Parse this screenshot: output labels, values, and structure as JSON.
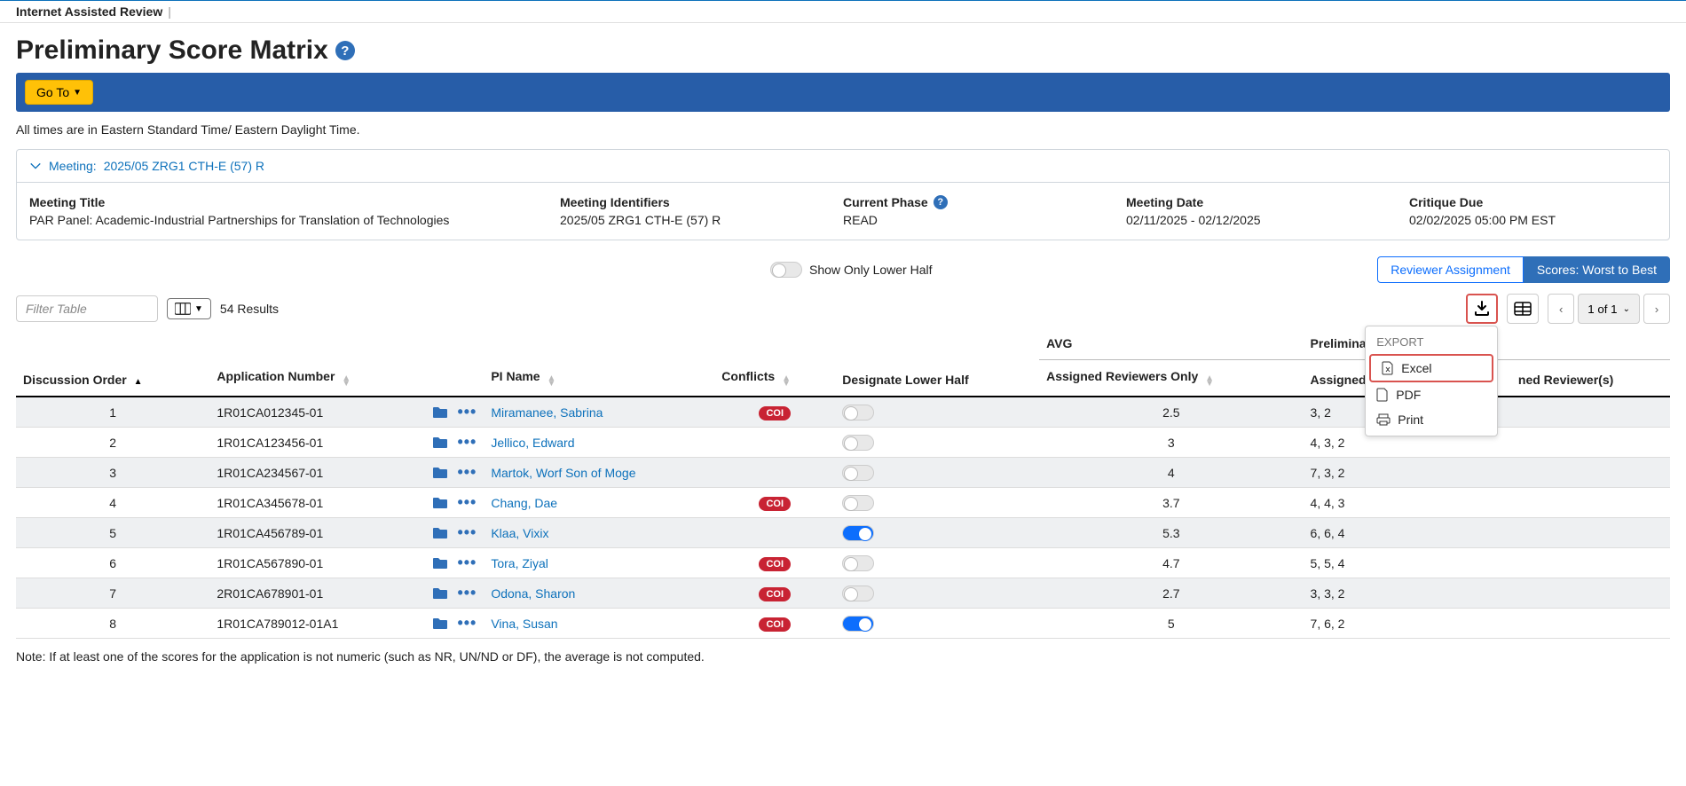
{
  "app_name": "Internet Assisted Review",
  "page_title": "Preliminary Score Matrix",
  "goto_label": "Go To",
  "timezone_note": "All times are in Eastern Standard Time/ Eastern Daylight Time.",
  "meeting": {
    "collapse_label": "Meeting:",
    "collapse_value": "2025/05 ZRG1 CTH-E (57) R",
    "title_label": "Meeting Title",
    "title_value": "PAR Panel: Academic-Industrial Partnerships for Translation of Technologies",
    "identifiers_label": "Meeting Identifiers",
    "identifiers_value": "2025/05 ZRG1 CTH-E (57) R",
    "phase_label": "Current Phase",
    "phase_value": "READ",
    "date_label": "Meeting Date",
    "date_value": "02/11/2025 - 02/12/2025",
    "critique_label": "Critique Due",
    "critique_value": "02/02/2025 05:00 PM EST"
  },
  "controls": {
    "lower_half_label": "Show Only Lower Half",
    "reviewer_assignment": "Reviewer Assignment",
    "scores_toggle": "Scores: Worst to Best",
    "filter_placeholder": "Filter Table",
    "results_count": "54 Results",
    "pager_text": "1 of 1"
  },
  "export_menu": {
    "title": "EXPORT",
    "excel": "Excel",
    "pdf": "PDF",
    "print": "Print"
  },
  "columns": {
    "discussion_order": "Discussion Order",
    "app_number": "Application Number",
    "pi_name": "PI Name",
    "conflicts": "Conflicts",
    "designate_lower": "Designate Lower Half",
    "avg_top": "AVG",
    "avg_sub": "Assigned Reviewers Only",
    "prelim_top": "Preliminary Overall/",
    "assigned_reviewers": "Assigned Reviewer(s)",
    "ned_reviewers": "ned Reviewer(s)"
  },
  "rows": [
    {
      "order": "1",
      "app": "1R01CA012345-01",
      "pi": "Miramanee, Sabrina",
      "coi": true,
      "lower_on": false,
      "avg": "2.5",
      "scores": "3, 2"
    },
    {
      "order": "2",
      "app": "1R01CA123456-01",
      "pi": "Jellico, Edward",
      "coi": false,
      "lower_on": false,
      "avg": "3",
      "scores": "4, 3, 2"
    },
    {
      "order": "3",
      "app": "1R01CA234567-01",
      "pi": "Martok, Worf Son of Moge",
      "coi": false,
      "lower_on": false,
      "avg": "4",
      "scores": "7, 3, 2"
    },
    {
      "order": "4",
      "app": "1R01CA345678-01",
      "pi": "Chang, Dae",
      "coi": true,
      "lower_on": false,
      "avg": "3.7",
      "scores": "4, 4, 3"
    },
    {
      "order": "5",
      "app": "1R01CA456789-01",
      "pi": "Klaa, Vixix",
      "coi": false,
      "lower_on": true,
      "avg": "5.3",
      "scores": "6, 6, 4"
    },
    {
      "order": "6",
      "app": "1R01CA567890-01",
      "pi": "Tora, Ziyal",
      "coi": true,
      "lower_on": false,
      "avg": "4.7",
      "scores": "5, 5, 4"
    },
    {
      "order": "7",
      "app": "2R01CA678901-01",
      "pi": "Odona, Sharon",
      "coi": true,
      "lower_on": false,
      "avg": "2.7",
      "scores": "3, 3, 2"
    },
    {
      "order": "8",
      "app": "1R01CA789012-01A1",
      "pi": "Vina, Susan",
      "coi": true,
      "lower_on": true,
      "avg": "5",
      "scores": "7, 6, 2"
    }
  ],
  "coi_label": "COI",
  "footnote": "Note: If at least one of the scores for the application is not numeric (such as NR, UN/ND or DF), the average is not computed."
}
